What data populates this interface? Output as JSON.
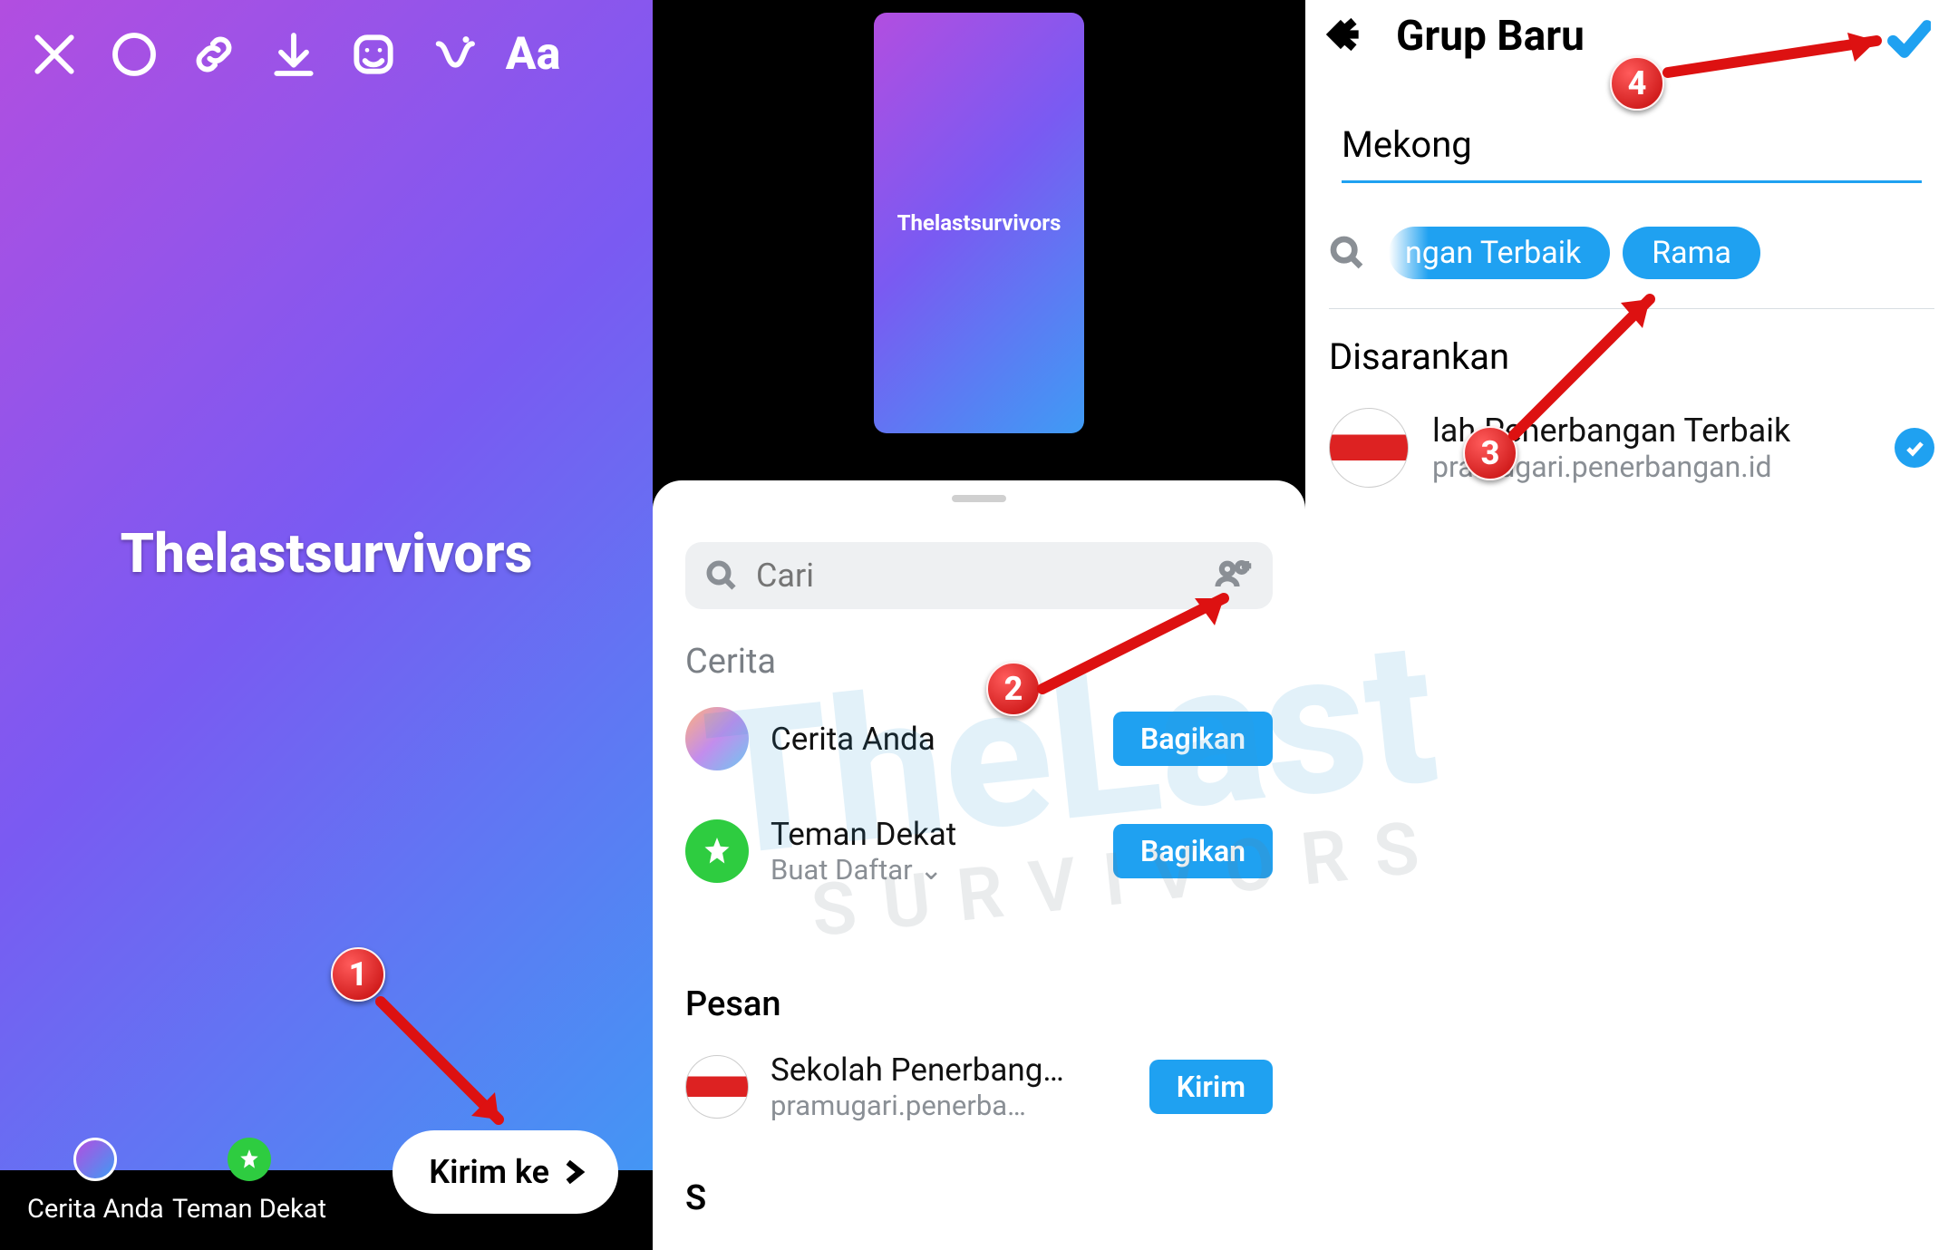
{
  "panel1": {
    "story_text": "Thelastsurvivors",
    "send_to_label": "Kirim ke",
    "bottom": {
      "your_story": "Cerita Anda",
      "close_friends": "Teman Dekat"
    },
    "top_icons": [
      "close-icon",
      "brush-icon",
      "link-icon",
      "download-icon",
      "sticker-icon",
      "effects-icon",
      "text-icon"
    ],
    "text_tool": "Aa"
  },
  "panel2": {
    "thumbnail_text": "Thelastsurvivors",
    "search_placeholder": "Cari",
    "section_cerita": "Cerita",
    "section_pesan": "Pesan",
    "section_s": "S",
    "rows": {
      "cerita_anda": {
        "title": "Cerita Anda",
        "sub": "",
        "button": "Bagikan"
      },
      "teman_dekat": {
        "title": "Teman Dekat",
        "sub": "Buat Daftar",
        "button": "Bagikan"
      },
      "pesan1": {
        "title": "Sekolah Penerbang…",
        "sub": "pramugari.penerba…",
        "button": "Kirim"
      }
    }
  },
  "panel3": {
    "title": "Grup Baru",
    "group_name_value": "Mekong",
    "chips": [
      "ngan Terbaik",
      "Rama"
    ],
    "suggested_label": "Disarankan",
    "suggested": {
      "title": "lah Penerbangan Terbaik",
      "sub": "pramugari.penerbangan.id"
    }
  },
  "badges": {
    "b1": "1",
    "b2": "2",
    "b3": "3",
    "b4": "4"
  },
  "watermark": "TheLast"
}
